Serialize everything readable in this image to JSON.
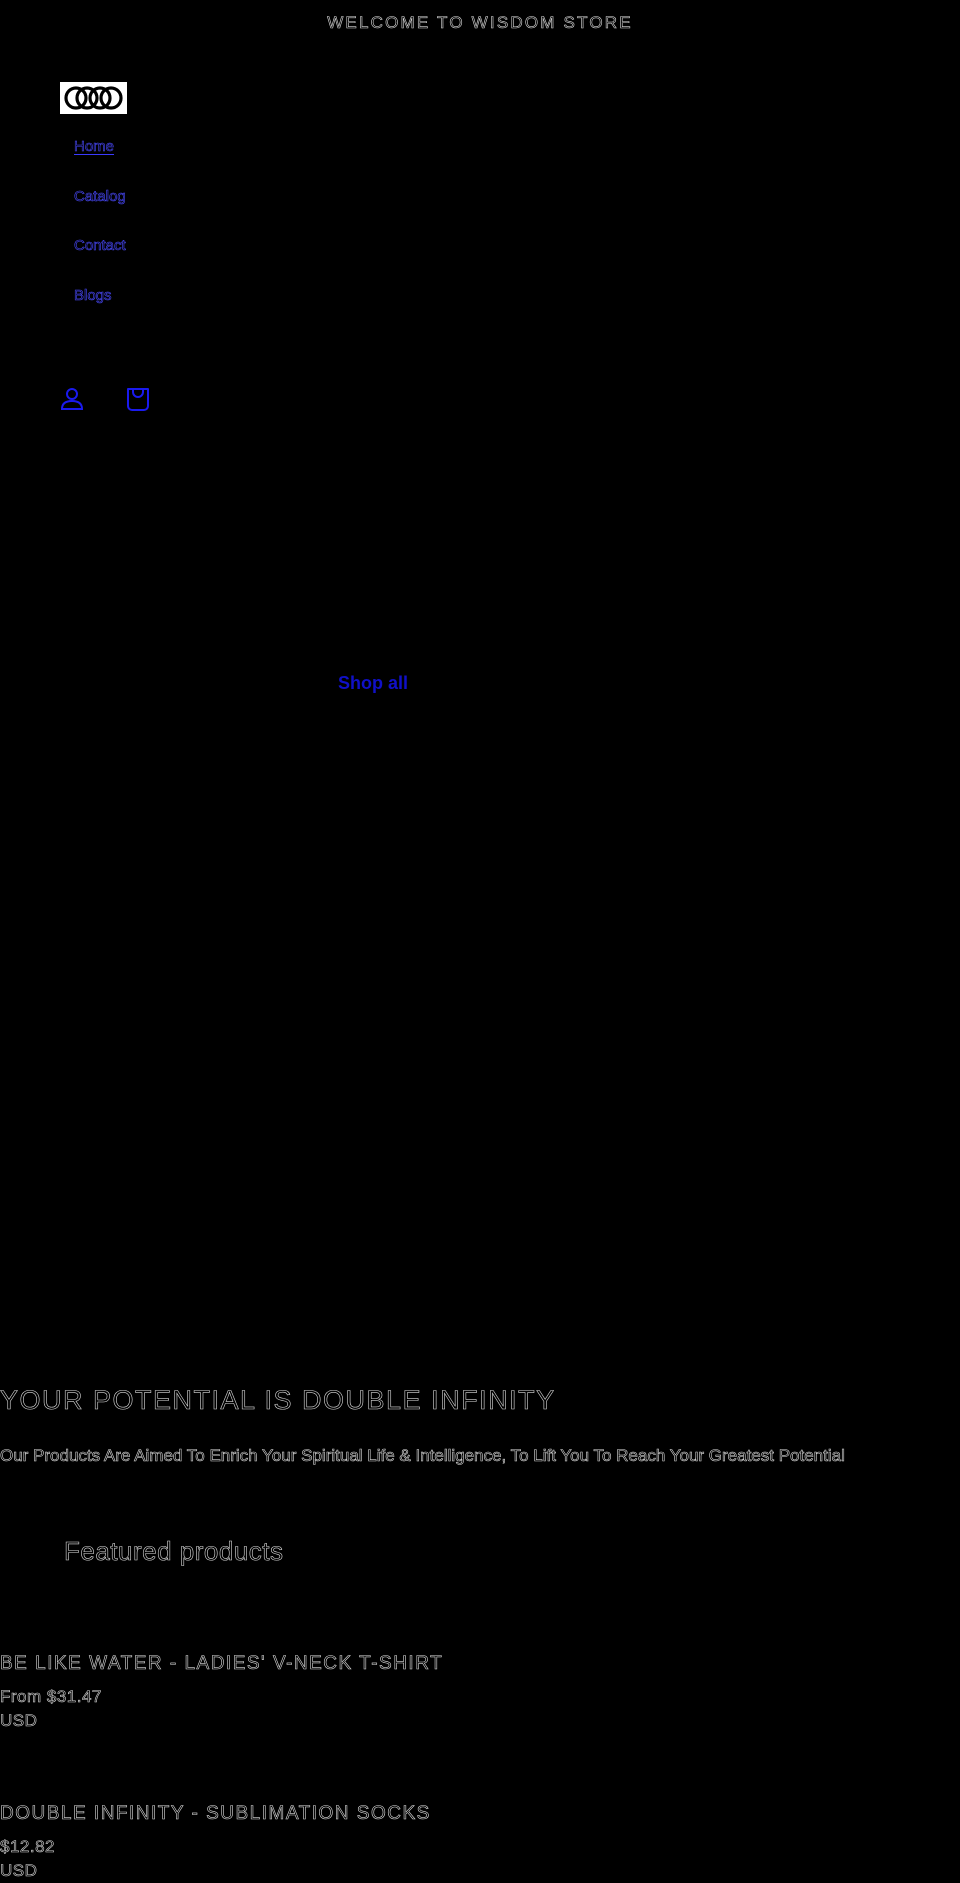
{
  "announcement": {
    "text": "WELCOME TO WISDOM STORE"
  },
  "header": {
    "logo_icon": "double-infinity-logo",
    "nav": [
      {
        "label": "Home",
        "active": true
      },
      {
        "label": "Catalog",
        "active": false
      },
      {
        "label": "Contact",
        "active": false
      },
      {
        "label": "Blogs",
        "active": false
      }
    ],
    "icons": [
      {
        "name": "account-icon"
      },
      {
        "name": "cart-icon"
      }
    ]
  },
  "hero": {
    "shop_all_label": "Shop all"
  },
  "intro": {
    "headline": "YOUR POTENTIAL IS DOUBLE INFINITY",
    "tagline": "Our Products Are Aimed To Enrich Your Spiritual Life & Intelligence, To Lift You To Reach Your Greatest Potential"
  },
  "featured": {
    "heading": "Featured products",
    "products": [
      {
        "title": "BE LIKE WATER - LADIES' V-NECK T-SHIRT",
        "price": "From $31.47",
        "currency": "USD"
      },
      {
        "title": "DOUBLE INFINITY - SUBLIMATION SOCKS",
        "price": "$12.82",
        "currency": "USD"
      }
    ]
  },
  "colors": {
    "background": "#000000",
    "link": "#3a3aff",
    "shop_all": "#1010c8",
    "text_outline": "#d8d8d8"
  }
}
